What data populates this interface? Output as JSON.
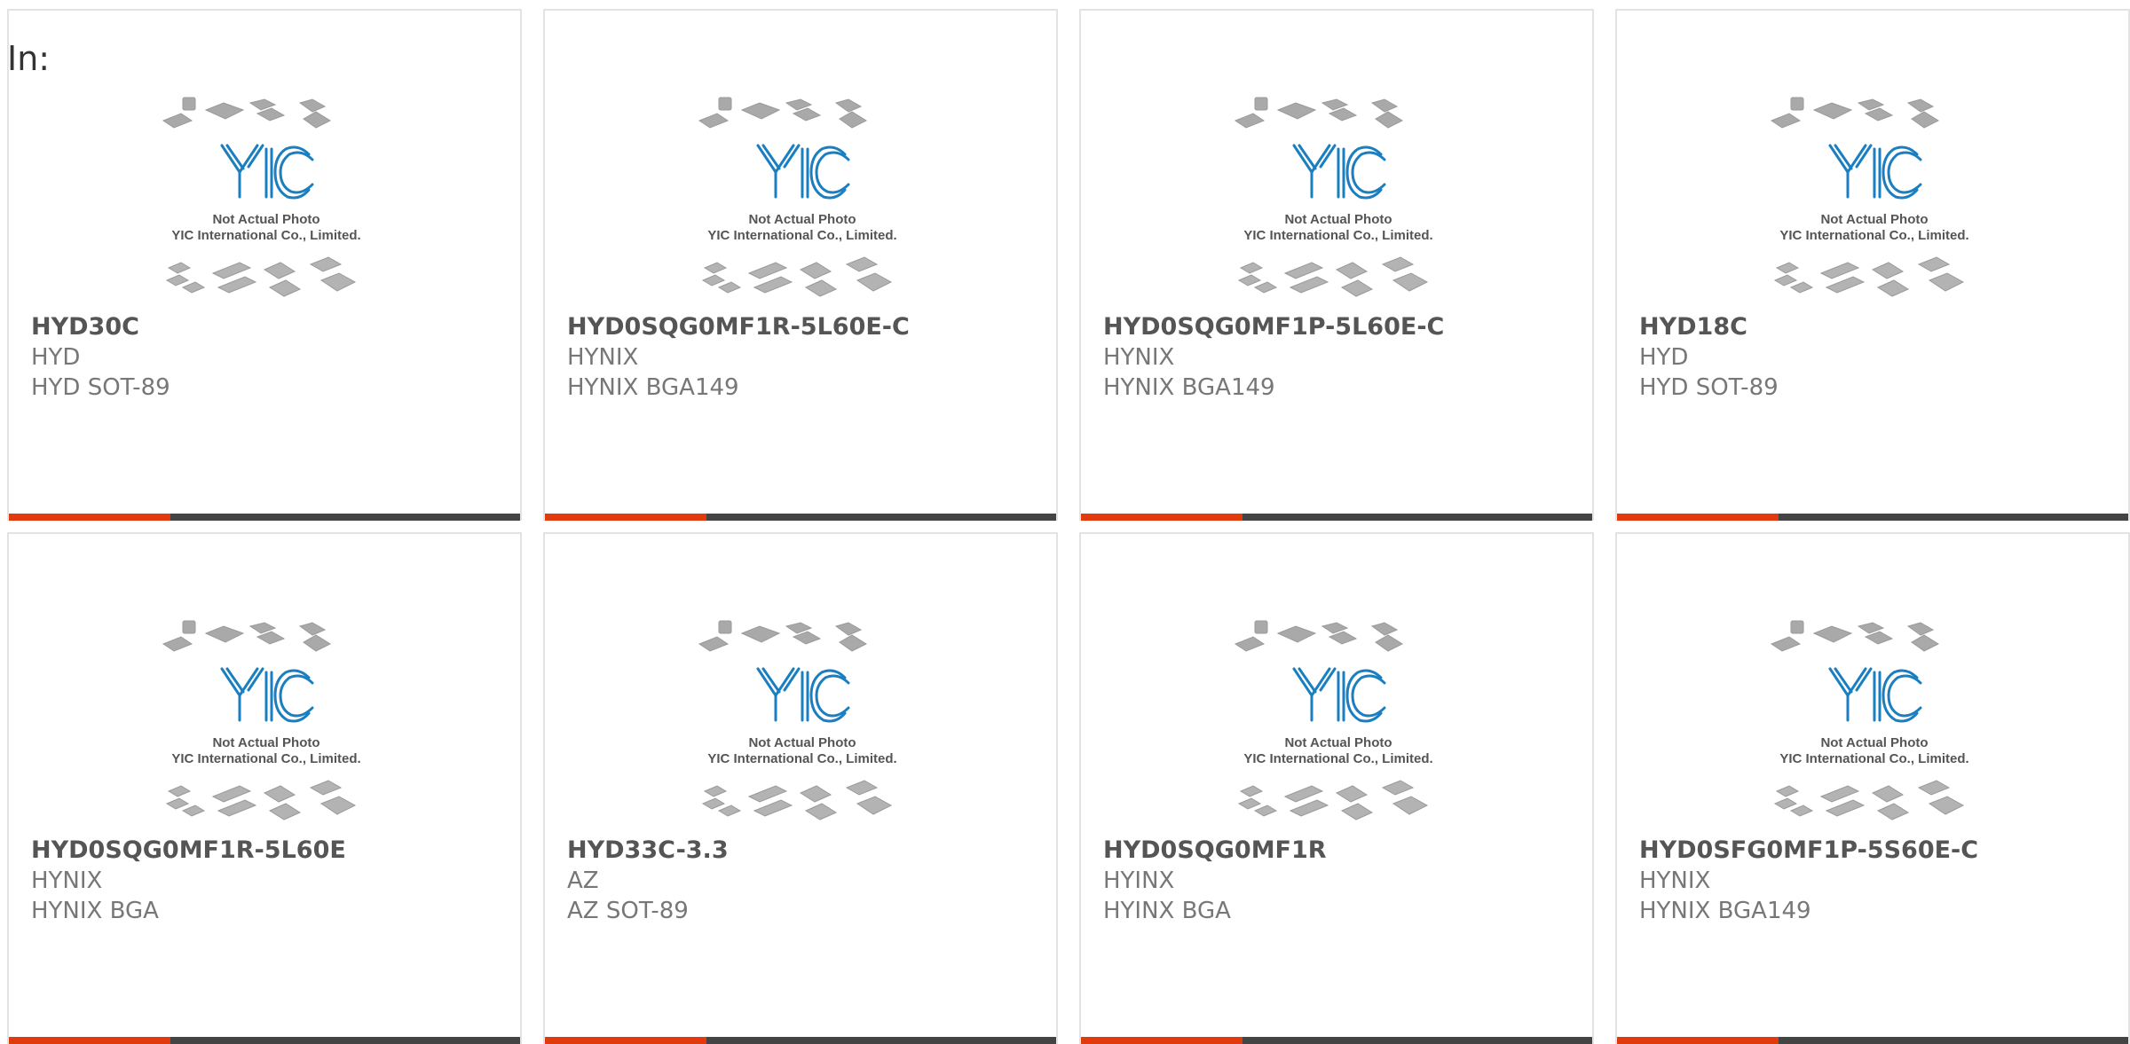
{
  "filter": {
    "label": "In:"
  },
  "photo": {
    "brand": "YIC",
    "caption_line1": "Not Actual Photo",
    "caption_line2": "YIC International Co., Limited."
  },
  "colors": {
    "accent": "#e23a0d",
    "bar": "#444444",
    "logo_blue": "#1a7fc1",
    "part_text": "#555555",
    "meta_text": "#777777"
  },
  "products": [
    {
      "part": "HYD30C",
      "brand": "HYD",
      "package": "HYD SOT-89"
    },
    {
      "part": "HYD0SQG0MF1R-5L60E-C",
      "brand": "HYNIX",
      "package": "HYNIX BGA149"
    },
    {
      "part": "HYD0SQG0MF1P-5L60E-C",
      "brand": "HYNIX",
      "package": "HYNIX BGA149"
    },
    {
      "part": "HYD18C",
      "brand": "HYD",
      "package": "HYD SOT-89"
    },
    {
      "part": "HYD0SQG0MF1R-5L60E",
      "brand": "HYNIX",
      "package": "HYNIX BGA"
    },
    {
      "part": "HYD33C-3.3",
      "brand": "AZ",
      "package": "AZ SOT-89"
    },
    {
      "part": "HYD0SQG0MF1R",
      "brand": "HYINX",
      "package": "HYINX BGA"
    },
    {
      "part": "HYD0SFG0MF1P-5S60E-C",
      "brand": "HYNIX",
      "package": "HYNIX BGA149"
    }
  ]
}
